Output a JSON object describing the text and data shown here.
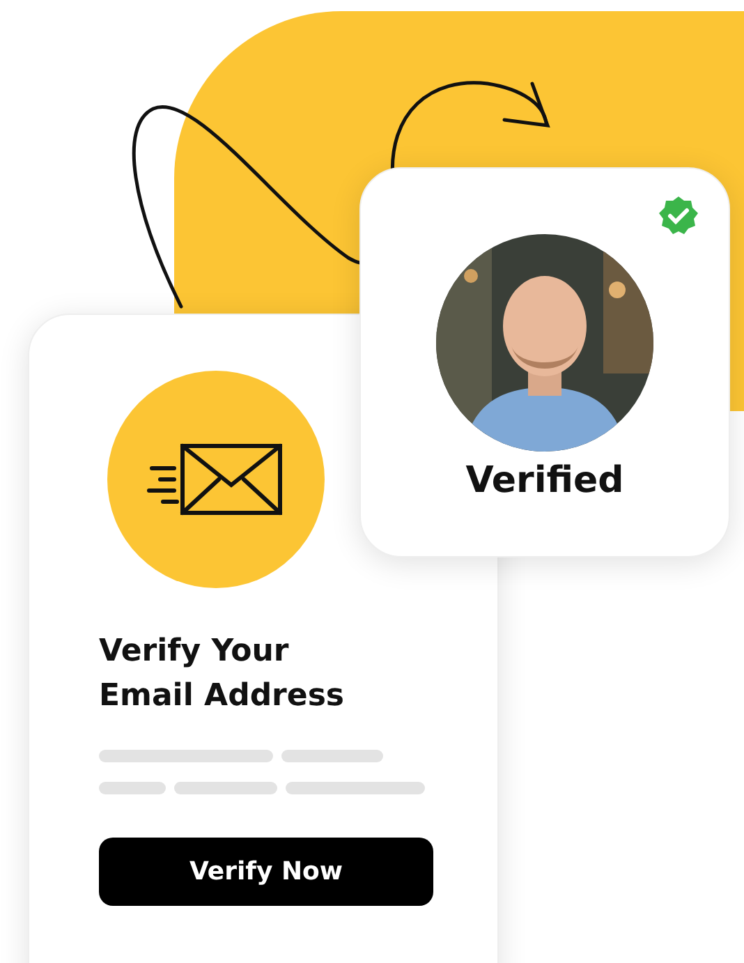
{
  "email_card": {
    "title": "Verify Your Email Address",
    "button": "Verify Now"
  },
  "verified_card": {
    "verified": true,
    "label": "Verified"
  }
}
